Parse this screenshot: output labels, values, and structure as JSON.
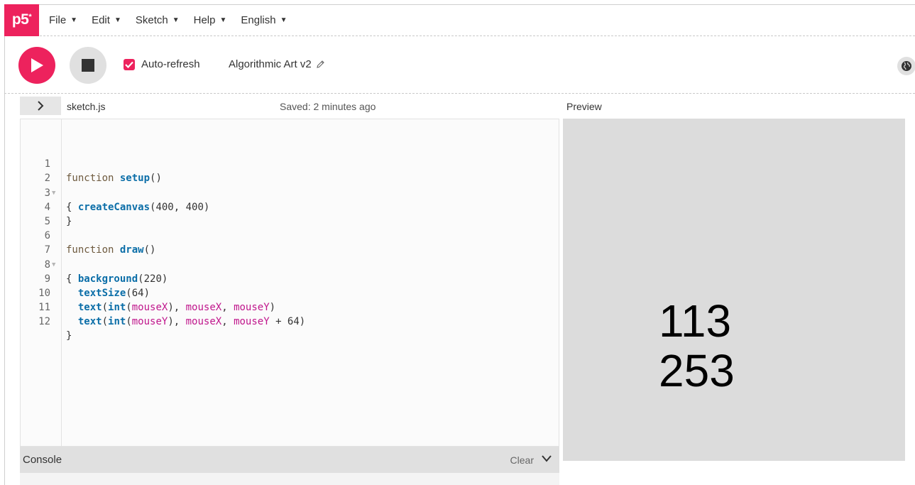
{
  "nav": {
    "logo_text": "p5",
    "logo_sup": "*",
    "menu": [
      {
        "label": "File"
      },
      {
        "label": "Edit"
      },
      {
        "label": "Sketch"
      },
      {
        "label": "Help"
      },
      {
        "label": "English"
      }
    ],
    "caret": "▼"
  },
  "toolbar": {
    "auto_refresh_label": "Auto-refresh",
    "auto_refresh_checked": true,
    "sketch_name": "Algorithmic Art v2",
    "accent_color": "#ed225d"
  },
  "editor": {
    "file_name": "sketch.js",
    "saved_status": "Saved: 2 minutes ago",
    "lines": [
      {
        "n": "1"
      },
      {
        "n": "2"
      },
      {
        "n": "3"
      },
      {
        "n": "4"
      },
      {
        "n": "5"
      },
      {
        "n": "6"
      },
      {
        "n": "7"
      },
      {
        "n": "8"
      },
      {
        "n": "9"
      },
      {
        "n": "10"
      },
      {
        "n": "11"
      },
      {
        "n": "12"
      }
    ],
    "code": {
      "l1_kw": "function",
      "l1_fn": "setup",
      "l1_rest": "()",
      "l2": "{",
      "l3_fn": "createCanvas",
      "l3_rest": "(400, 400)",
      "l4": "}",
      "l6_kw": "function",
      "l6_fn": "draw",
      "l6_rest": "()",
      "l7": "{",
      "l8_fn": "background",
      "l8_rest": "(220)",
      "l9_fn": "textSize",
      "l9_rest": "(64)",
      "l10_fn": "text",
      "l10_p1": "(",
      "l10_fn2": "int",
      "l10_p2": "(",
      "l10_v1": "mouseX",
      "l10_p3": "), ",
      "l10_v2": "mouseX",
      "l10_p4": ", ",
      "l10_v3": "mouseY",
      "l10_p5": ")",
      "l11_fn": "text",
      "l11_p1": "(",
      "l11_fn2": "int",
      "l11_p2": "(",
      "l11_v1": "mouseY",
      "l11_p3": "), ",
      "l11_v2": "mouseX",
      "l11_p4": ", ",
      "l11_v3": "mouseY",
      "l11_p5": " + 64)",
      "l12": "}"
    }
  },
  "console": {
    "title": "Console",
    "clear_label": "Clear"
  },
  "preview": {
    "label": "Preview",
    "line1": "113",
    "line2": "253"
  }
}
